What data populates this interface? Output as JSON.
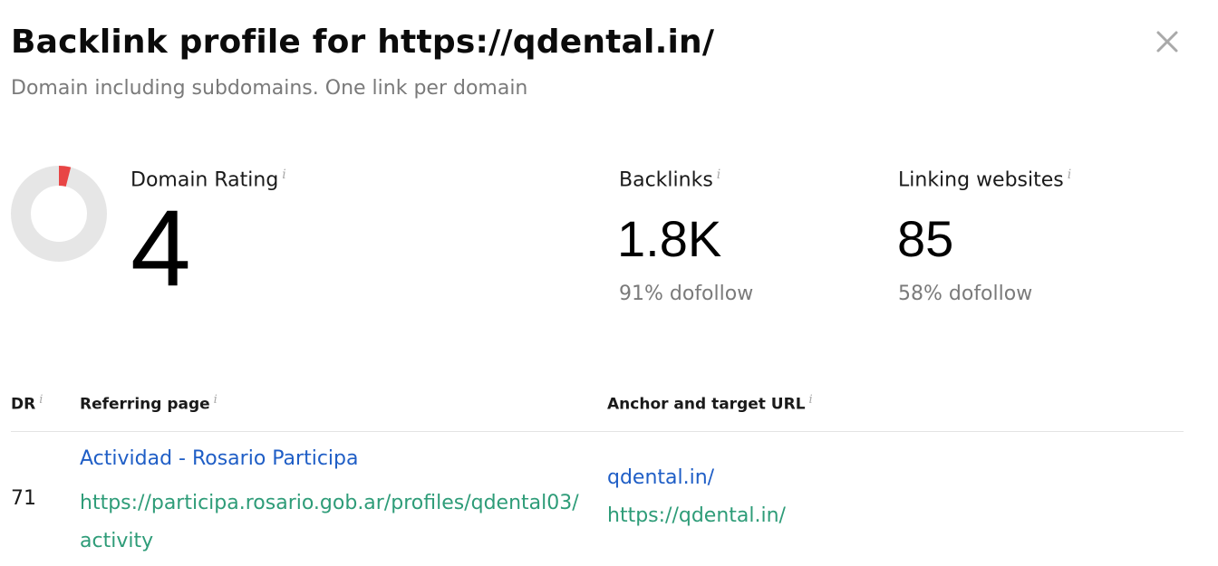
{
  "header": {
    "title": "Backlink profile for https://qdental.in/",
    "subtitle": "Domain including subdomains. One link per domain"
  },
  "icons": {
    "close": "close-icon",
    "info": "info-icon"
  },
  "colors": {
    "donut_fill": "#e84545",
    "donut_track": "#e6e6e6",
    "link_title": "#1f5ec6",
    "link_url": "#2e9c78",
    "muted": "#7a7a7a"
  },
  "metrics": {
    "domain_rating": {
      "label": "Domain Rating",
      "info": "i",
      "value": "4",
      "max": 100
    },
    "backlinks": {
      "label": "Backlinks",
      "info": "i",
      "value": "1.8K",
      "sub": "91% dofollow"
    },
    "linking_websites": {
      "label": "Linking websites",
      "info": "i",
      "value": "85",
      "sub": "58% dofollow"
    }
  },
  "table": {
    "columns": [
      {
        "label": "DR",
        "info": "i"
      },
      {
        "label": "Referring page",
        "info": "i"
      },
      {
        "label": "Anchor and target URL",
        "info": "i"
      }
    ],
    "rows": [
      {
        "dr": "71",
        "ref_title": "Actividad - Rosario Participa",
        "ref_url": "https://participa.rosario.gob.ar/profiles/qdental03/activity",
        "anchor": "qdental.in/",
        "target_url": "https://qdental.in/"
      }
    ]
  }
}
